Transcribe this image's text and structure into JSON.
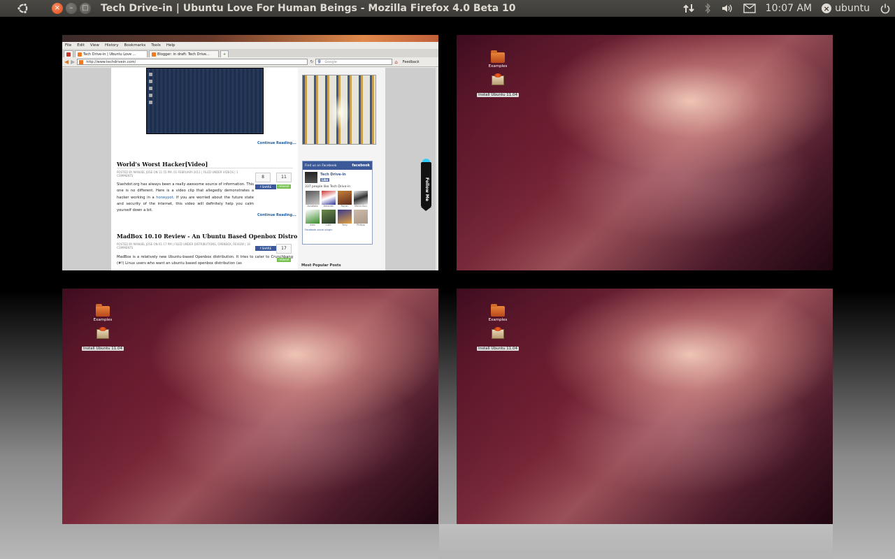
{
  "panel": {
    "window_title": "Tech Drive-in | Ubuntu Love For Human Beings - Mozilla Firefox 4.0 Beta 10",
    "time": "10:07 AM",
    "user": "ubuntu",
    "window_controls": {
      "close": "×",
      "minimize": "–",
      "maximize": "□"
    }
  },
  "firefox": {
    "menu": [
      "File",
      "Edit",
      "View",
      "History",
      "Bookmarks",
      "Tools",
      "Help"
    ],
    "tabs": [
      {
        "label": "Tech Drive-in | Ubuntu Love ..."
      },
      {
        "label": "Blogger: in draft: Tech Drive..."
      }
    ],
    "url": "http://www.techdrivein.com/",
    "search_placeholder": "Google",
    "feedback": "Feedback"
  },
  "webpage": {
    "continue_label_1": "Continue Reading...",
    "post1": {
      "title": "World's Worst Hacker[Video]",
      "meta": "POSTED BY MANUEL JOSE ON 11:55 PM, 01-FEBRUARY-2011 | FILED UNDER VIDEOS | 1 COMMENTS",
      "share_count": "8",
      "tweet_count": "11",
      "text_1": "Slashdot.org has always been a really awesome source of information. This one is no different. Here is a video clip that allegedly demonstrates a hacker working in a",
      "link": "honeypot",
      "text_2": ". If you are worried about the future state and security of the internet, this video will definitely help you calm yourself down a bit.",
      "continue_label": "Continue Reading..."
    },
    "post2": {
      "title": "MadBox 10.10 Review - An Ubuntu Based Openbox Distro",
      "meta": "POSTED BY MANUEL JOSE ON 01:17 PM | FILED UNDER DISTRIBUTIONS, OPENBOX, REVIEW | 16 COMMENTS",
      "share_count": "17",
      "text": "MadBox is a relatively new Ubuntu-based Openbox distribution. It tries to cater to Crunchbang (#!) Linux users who want an ubuntu based openbox distribution (as"
    },
    "facebook": {
      "header": "Find us on Facebook",
      "brand": "facebook",
      "page_name": "Tech Drive-in",
      "like": "Like",
      "count_text": "337 people like Tech Drive-in",
      "faces": [
        "Avodipta",
        "Deborah",
        "Rayan",
        "Mahir-Sou",
        "Alex",
        "Lalit",
        "Tony",
        "Philipp"
      ],
      "footer": "Facebook social plugin"
    },
    "popular_heading": "Most Popular Posts",
    "follow_me": "Follow Me"
  },
  "desktop_icons": [
    {
      "label": "Examples"
    },
    {
      "label": "Install Ubuntu 11.04"
    }
  ]
}
